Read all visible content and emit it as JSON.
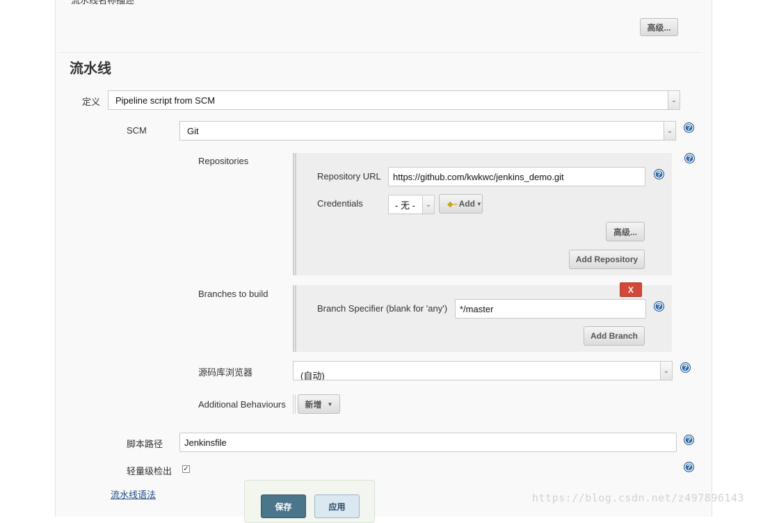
{
  "page": {
    "truncated_heading": "流水线名称描述",
    "advanced_button_top": "高级...",
    "section_title": "流水线"
  },
  "definition": {
    "label": "定义",
    "value": "Pipeline script from SCM"
  },
  "scm": {
    "label": "SCM",
    "value": "Git"
  },
  "repositories": {
    "label": "Repositories",
    "repository_url_label": "Repository URL",
    "repository_url_value": "https://github.com/kwkwc/jenkins_demo.git",
    "credentials_label": "Credentials",
    "credentials_value": "- 无 -",
    "add_credentials_label": "Add",
    "advanced_button": "高级...",
    "add_repository_button": "Add Repository"
  },
  "branches": {
    "label": "Branches to build",
    "delete_button": "X",
    "branch_specifier_label": "Branch Specifier (blank for 'any')",
    "branch_specifier_value": "*/master",
    "add_branch_button": "Add Branch"
  },
  "repo_browser": {
    "label": "源码库浏览器",
    "value": "(自动)"
  },
  "additional_behaviours": {
    "label": "Additional Behaviours",
    "add_button": "新增"
  },
  "script_path": {
    "label": "脚本路径",
    "value": "Jenkinsfile"
  },
  "lightweight": {
    "label": "轻量级检出",
    "checked": true
  },
  "pipeline_syntax_link": "流水线语法",
  "actions": {
    "save_button": "保存",
    "apply_button": "应用"
  },
  "watermark": "https://blog.csdn.net/z497896143",
  "colors": {
    "help_icon": "#2e6aa8",
    "save_button": "#4b758b",
    "delete_button": "#d24939"
  }
}
